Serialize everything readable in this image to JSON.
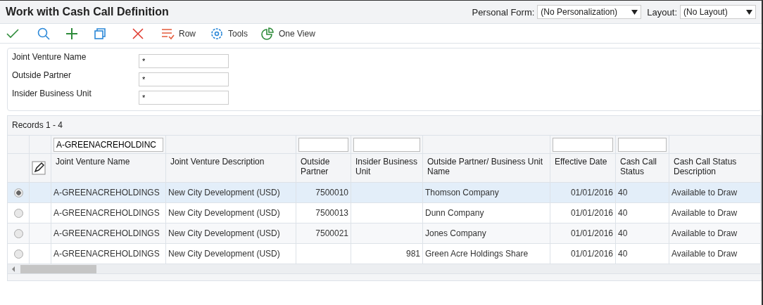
{
  "window": {
    "title": "Work with Cash Call Definition"
  },
  "personal_form": {
    "label": "Personal Form:",
    "value": "(No Personalization)"
  },
  "layout": {
    "label": "Layout:",
    "value": "(No Layout)"
  },
  "toolbar": [
    {
      "kind": "check"
    },
    {
      "kind": "search"
    },
    {
      "kind": "add"
    },
    {
      "kind": "copy"
    },
    {
      "kind": "delete"
    },
    {
      "kind": "row",
      "label": "Row"
    },
    {
      "kind": "tools",
      "label": "Tools"
    },
    {
      "kind": "oneview",
      "label": "One View"
    }
  ],
  "criteria": [
    {
      "label": "Joint Venture Name",
      "value": "*"
    },
    {
      "label": "Outside Partner",
      "value": "*"
    },
    {
      "label": "Insider Business Unit",
      "value": "*"
    }
  ],
  "grid": {
    "records": "Records 1 - 4",
    "columns": [
      {
        "label": "Joint Venture Name",
        "kind": "text",
        "has_filter": true,
        "filter": "A-GREENACREHOLDINC"
      },
      {
        "label": "Joint Venture Description",
        "kind": "text",
        "has_filter": false
      },
      {
        "label": "Outside Partner",
        "kind": "number",
        "has_filter": true
      },
      {
        "label": "Insider Business Unit",
        "kind": "number",
        "has_filter": true
      },
      {
        "label": "Outside Partner/ Business Unit Name",
        "kind": "text",
        "has_filter": false
      },
      {
        "label": "Effective Date",
        "kind": "number",
        "has_filter": true
      },
      {
        "label": "Cash Call Status",
        "kind": "text",
        "has_filter": true
      },
      {
        "label": "Cash Call Status Description",
        "kind": "text",
        "has_filter": false
      }
    ],
    "rows": [
      {
        "selected": true,
        "cells": [
          "A-GREENACREHOLDINGS",
          "New City Development (USD)",
          "7500010",
          "",
          "Thomson Company",
          "01/01/2016",
          "40",
          "Available to Draw"
        ]
      },
      {
        "selected": false,
        "cells": [
          "A-GREENACREHOLDINGS",
          "New City Development (USD)",
          "7500013",
          "",
          "Dunn Company",
          "01/01/2016",
          "40",
          "Available to Draw"
        ]
      },
      {
        "selected": false,
        "cells": [
          "A-GREENACREHOLDINGS",
          "New City Development (USD)",
          "7500021",
          "",
          "Jones Company",
          "01/01/2016",
          "40",
          "Available to Draw"
        ]
      },
      {
        "selected": false,
        "cells": [
          "A-GREENACREHOLDINGS",
          "New City Development (USD)",
          "",
          "981",
          "Green Acre Holdings Share",
          "01/01/2016",
          "40",
          "Available to Draw"
        ]
      }
    ]
  }
}
